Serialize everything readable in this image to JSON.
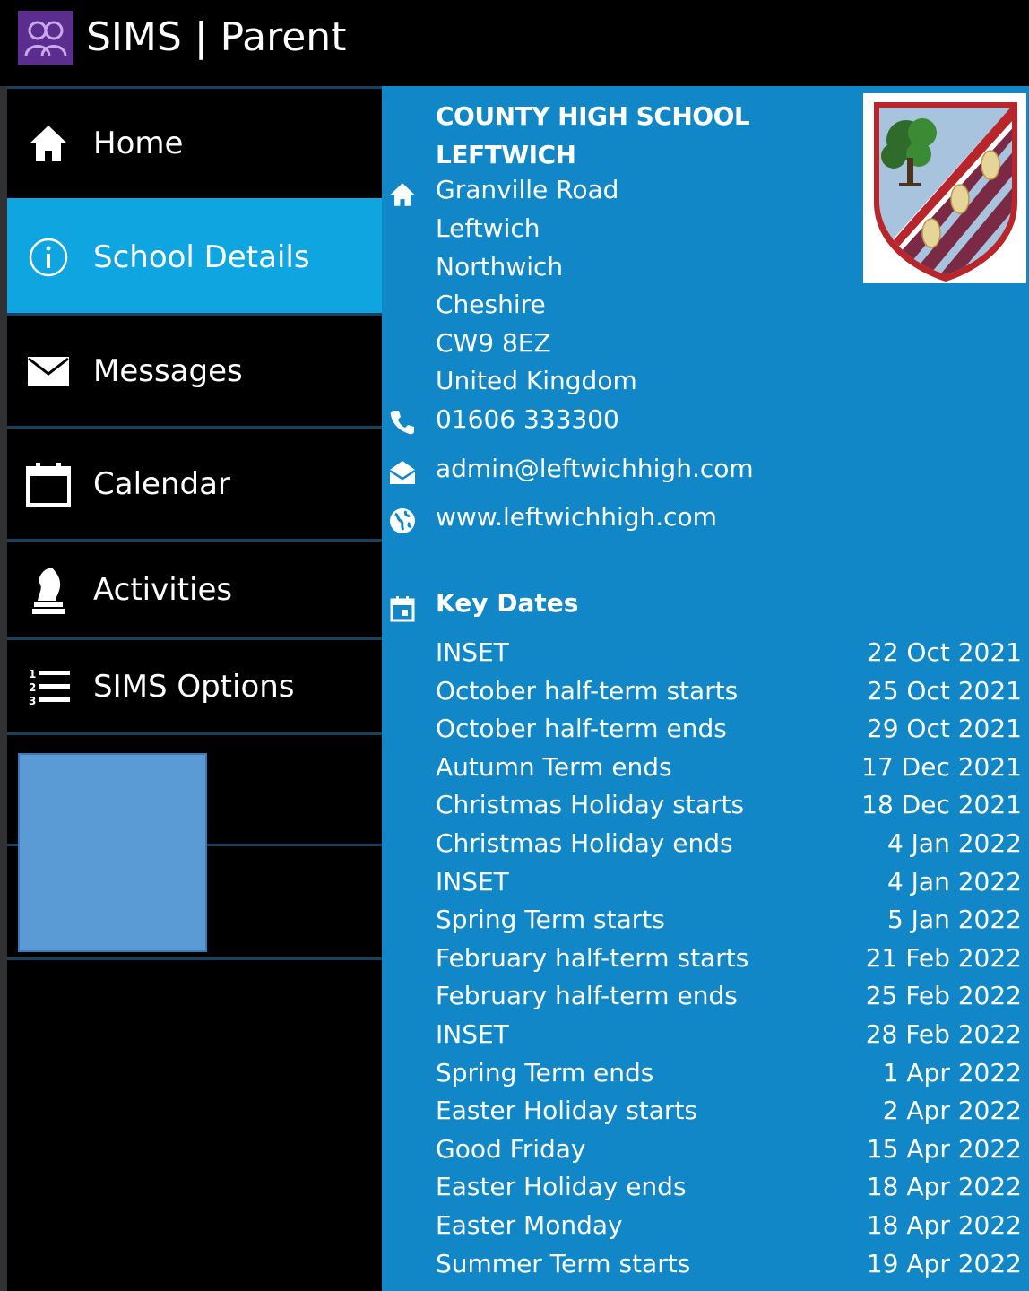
{
  "app": {
    "title": "SIMS | Parent"
  },
  "sidebar": {
    "items": [
      {
        "label": "Home",
        "icon": "home-icon"
      },
      {
        "label": "School Details",
        "icon": "info-icon"
      },
      {
        "label": "Messages",
        "icon": "envelope-icon"
      },
      {
        "label": "Calendar",
        "icon": "calendar-icon"
      },
      {
        "label": "Activities",
        "icon": "chess-knight-icon"
      },
      {
        "label": "SIMS Options",
        "icon": "numbered-list-icon"
      }
    ],
    "active_index": 1
  },
  "school": {
    "name_line1": "COUNTY HIGH SCHOOL",
    "name_line2": "LEFTWICH",
    "address": [
      "Granville Road",
      "Leftwich",
      "Northwich",
      "Cheshire",
      "CW9 8EZ",
      "United Kingdom"
    ],
    "phone": "01606 333300",
    "email": "admin@leftwichhigh.com",
    "website": "www.leftwichhigh.com"
  },
  "key_dates": {
    "title": "Key Dates",
    "rows": [
      {
        "event": "INSET",
        "date": "22 Oct 2021"
      },
      {
        "event": "October half-term starts",
        "date": "25 Oct 2021"
      },
      {
        "event": "October half-term ends",
        "date": "29 Oct 2021"
      },
      {
        "event": "Autumn Term ends",
        "date": "17 Dec 2021"
      },
      {
        "event": "Christmas Holiday starts",
        "date": "18 Dec 2021"
      },
      {
        "event": "Christmas Holiday ends",
        "date": "4 Jan 2022"
      },
      {
        "event": "INSET",
        "date": "4 Jan 2022"
      },
      {
        "event": "Spring Term starts",
        "date": "5 Jan 2022"
      },
      {
        "event": "February half-term starts",
        "date": "21 Feb 2022"
      },
      {
        "event": "February half-term ends",
        "date": "25 Feb 2022"
      },
      {
        "event": "INSET",
        "date": "28 Feb 2022"
      },
      {
        "event": "Spring Term ends",
        "date": "1 Apr 2022"
      },
      {
        "event": "Easter Holiday starts",
        "date": "2 Apr 2022"
      },
      {
        "event": "Good Friday",
        "date": "15 Apr 2022"
      },
      {
        "event": "Easter Holiday ends",
        "date": "18 Apr 2022"
      },
      {
        "event": "Easter Monday",
        "date": "18 Apr 2022"
      },
      {
        "event": "Summer Term starts",
        "date": "19 Apr 2022"
      }
    ]
  },
  "colors": {
    "main_bg": "#1187c7",
    "active_nav": "#0ea5e0",
    "sidebar_bg": "#000000",
    "logo_bg": "#5b2d8e"
  }
}
